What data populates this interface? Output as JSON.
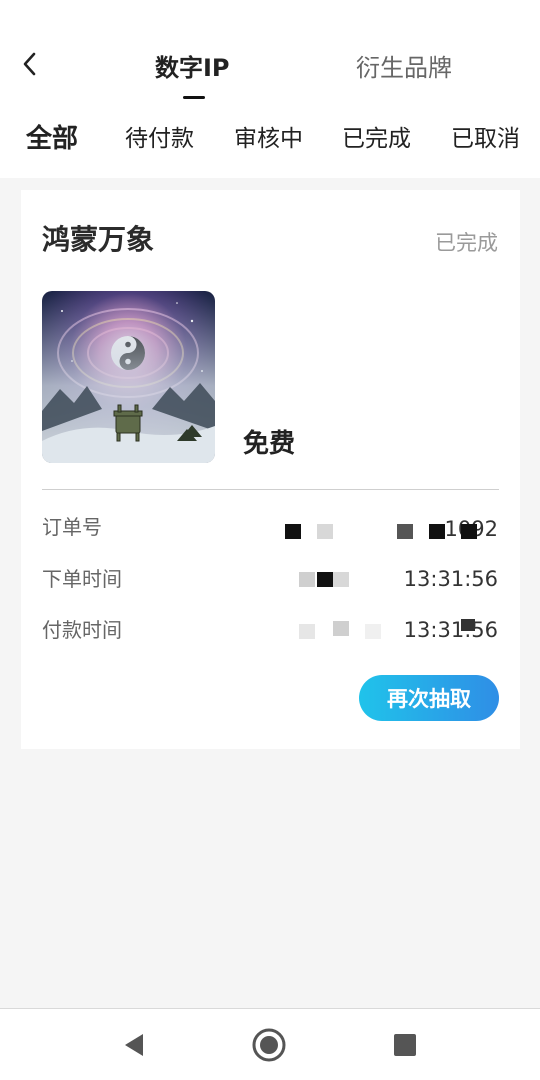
{
  "header": {
    "tabs": [
      {
        "label": "数字IP",
        "active": true
      },
      {
        "label": "衍生品牌",
        "active": false
      }
    ],
    "filters": [
      {
        "label": "全部",
        "active": true
      },
      {
        "label": "待付款",
        "active": false
      },
      {
        "label": "审核中",
        "active": false
      },
      {
        "label": "已完成",
        "active": false
      },
      {
        "label": "已取消",
        "active": false
      }
    ]
  },
  "order": {
    "title": "鸿蒙万象",
    "status": "已完成",
    "price": "免费",
    "fields": [
      {
        "label": "订单号",
        "value": "1092"
      },
      {
        "label": "下单时间",
        "value": "13:31:56"
      },
      {
        "label": "付款时间",
        "value": "13:31:56"
      }
    ],
    "action_label": "再次抽取"
  },
  "colors": {
    "accent_start": "#20c3ea",
    "accent_end": "#2f8ee6",
    "background": "#f5f5f5"
  },
  "icons": {
    "back": "chevron-left-icon",
    "nav_back": "triangle-back-icon",
    "nav_home": "circle-home-icon",
    "nav_recents": "square-recents-icon"
  }
}
